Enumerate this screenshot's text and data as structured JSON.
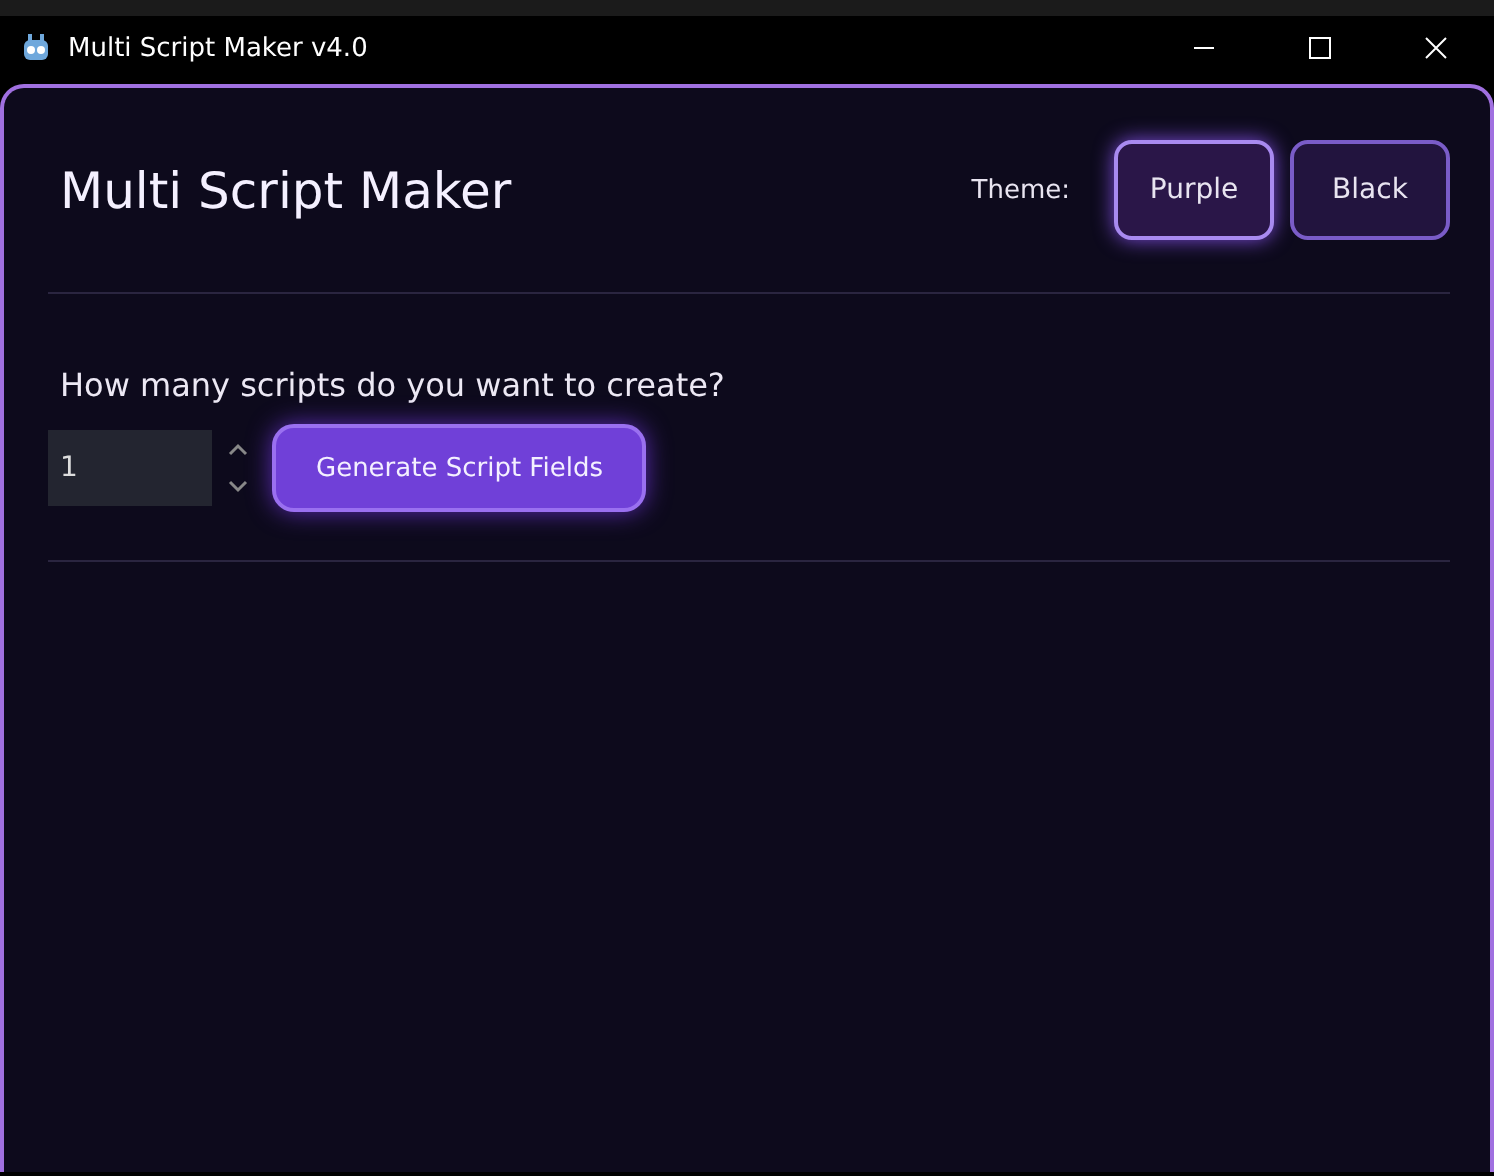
{
  "window": {
    "title": "Multi Script Maker v4.0"
  },
  "header": {
    "title": "Multi Script Maker",
    "theme_label": "Theme:",
    "themes": [
      {
        "label": "Purple",
        "selected": true
      },
      {
        "label": "Black",
        "selected": false
      }
    ]
  },
  "form": {
    "question": "How many scripts do you want to create?",
    "count": "1",
    "button": "Generate Script Fields"
  }
}
